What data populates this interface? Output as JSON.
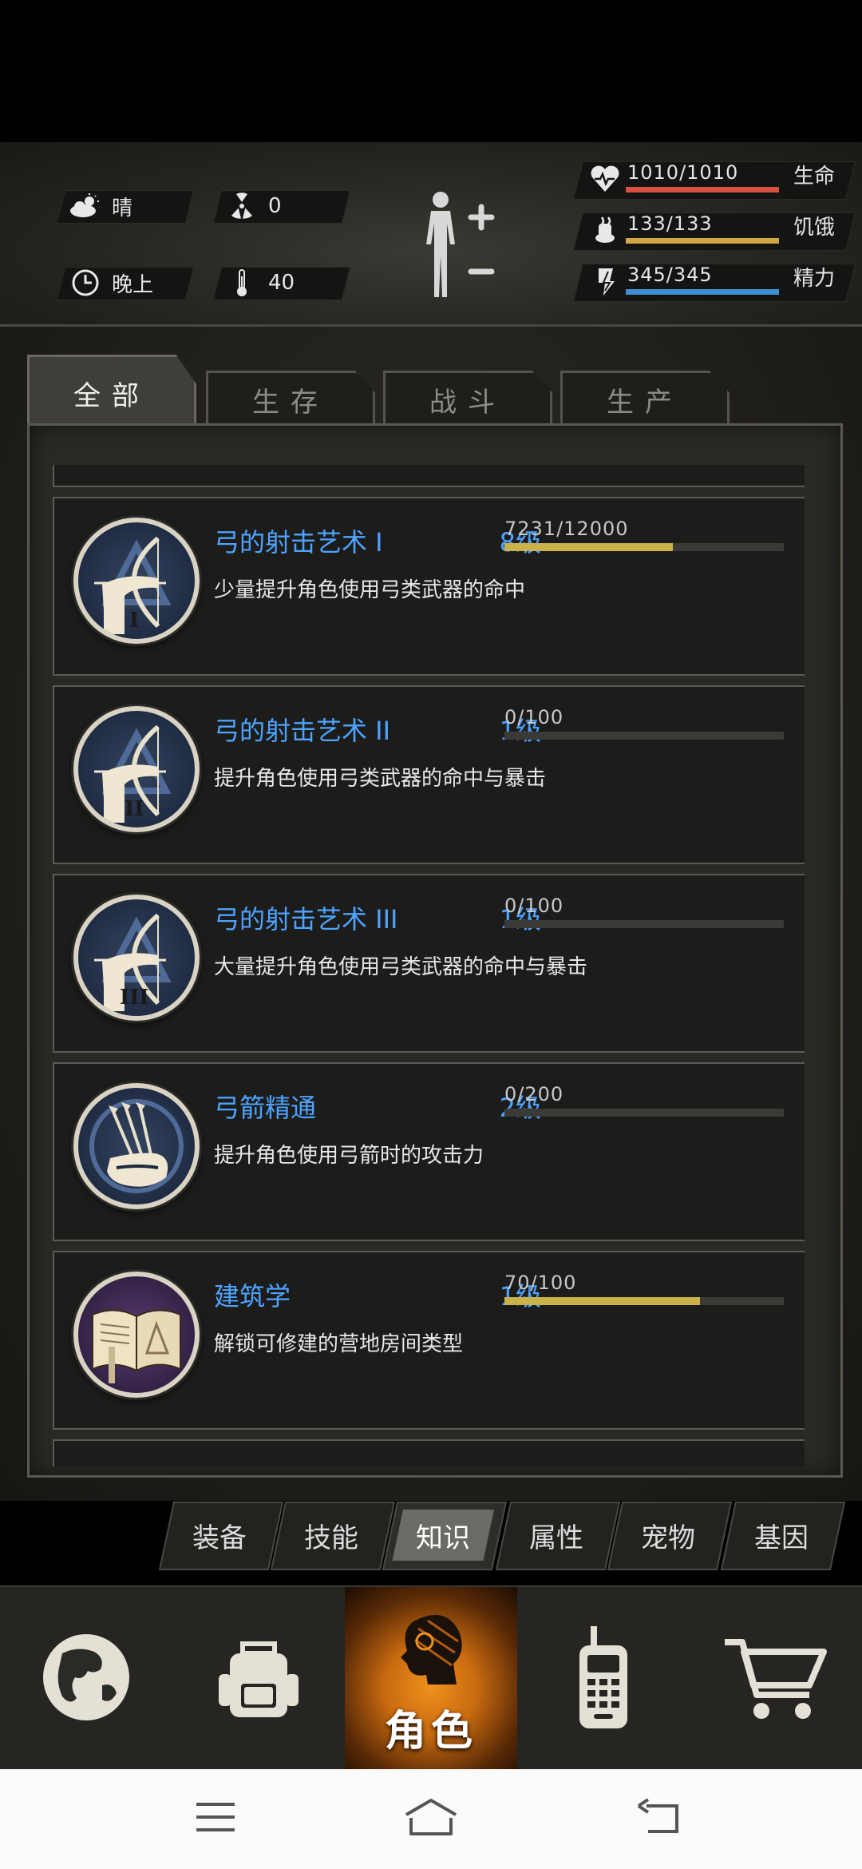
{
  "status": {
    "weather": {
      "icon": "cloud-sun-icon",
      "label": "晴"
    },
    "radiation": {
      "icon": "radiation-icon",
      "value": "0"
    },
    "time_of_day": {
      "icon": "clock-icon",
      "label": "晚上"
    },
    "temperature": {
      "icon": "thermometer-icon",
      "value": "40"
    },
    "bars": [
      {
        "icon": "heart-icon",
        "text": "1010/1010",
        "label": "生命",
        "fraction": 1.0,
        "color": "#d9503f"
      },
      {
        "icon": "hunger-icon",
        "text": "133/133",
        "label": "饥饿",
        "fraction": 1.0,
        "color": "#d2a642"
      },
      {
        "icon": "energy-icon",
        "text": "345/345",
        "label": "精力",
        "fraction": 1.0,
        "color": "#3f8fd6"
      }
    ]
  },
  "tabs": [
    {
      "label": "全部",
      "active": true
    },
    {
      "label": "生存",
      "active": false
    },
    {
      "label": "战斗",
      "active": false
    },
    {
      "label": "生产",
      "active": false
    }
  ],
  "skills": [
    {
      "icon": "bow-archer-icon",
      "numeral": "I",
      "title": "弓的射击艺术 I",
      "level": "8级",
      "progress": "7231/12000",
      "fraction": 0.6026,
      "desc": "少量提升角色使用弓类武器的命中"
    },
    {
      "icon": "bow-archer-icon",
      "numeral": "II",
      "title": "弓的射击艺术 II",
      "level": "1级",
      "progress": "0/100",
      "fraction": 0.0,
      "desc": "提升角色使用弓类武器的命中与暴击"
    },
    {
      "icon": "bow-archer-icon",
      "numeral": "III",
      "title": "弓的射击艺术 III",
      "level": "1级",
      "progress": "0/100",
      "fraction": 0.0,
      "desc": "大量提升角色使用弓类武器的命中与暴击"
    },
    {
      "icon": "quiver-icon",
      "numeral": "",
      "title": "弓箭精通",
      "level": "2级",
      "progress": "0/200",
      "fraction": 0.0,
      "desc": "提升角色使用弓箭时的攻击力"
    },
    {
      "icon": "book-icon",
      "numeral": "",
      "title": "建筑学",
      "level": "1级",
      "progress": "70/100",
      "fraction": 0.7,
      "desc": "解锁可修建的营地房间类型"
    }
  ],
  "categories": [
    {
      "label": "装备",
      "active": false
    },
    {
      "label": "技能",
      "active": false
    },
    {
      "label": "知识",
      "active": true
    },
    {
      "label": "属性",
      "active": false
    },
    {
      "label": "宠物",
      "active": false
    },
    {
      "label": "基因",
      "active": false
    }
  ],
  "nav": [
    {
      "icon": "globe-icon",
      "label": ""
    },
    {
      "icon": "backpack-icon",
      "label": ""
    },
    {
      "icon": "character-head-icon",
      "label": "角色",
      "active": true
    },
    {
      "icon": "walkie-talkie-icon",
      "label": ""
    },
    {
      "icon": "shopping-cart-icon",
      "label": ""
    }
  ]
}
